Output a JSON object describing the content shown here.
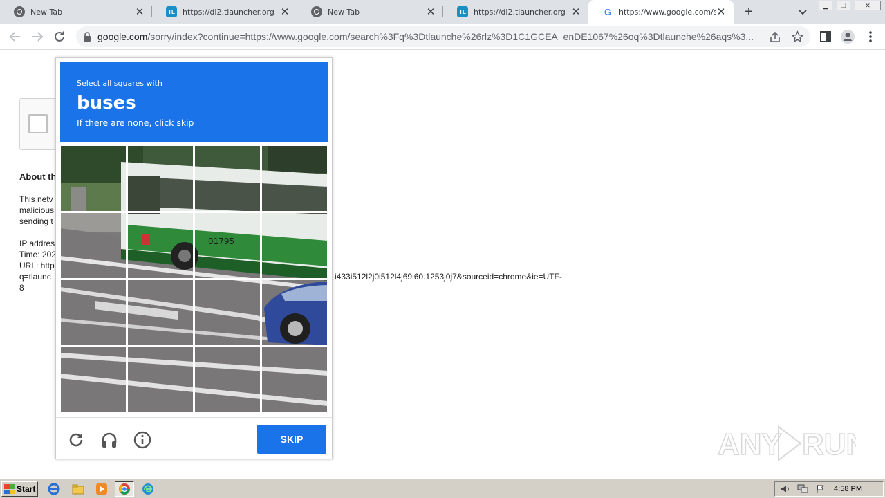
{
  "browser": {
    "tabs": [
      {
        "title": "New Tab",
        "favicon": "chrome-icon"
      },
      {
        "title": "https://dl2.tlauncher.org",
        "favicon": "tlauncher-icon"
      },
      {
        "title": "New Tab",
        "favicon": "chrome-icon"
      },
      {
        "title": "https://dl2.tlauncher.org",
        "favicon": "tlauncher-icon"
      },
      {
        "title": "https://www.google.com/search",
        "favicon": "google-icon",
        "active": true
      }
    ],
    "tab_close_glyph": "✕",
    "new_tab_glyph": "+",
    "url_host": "google.com",
    "url_path": "/sorry/index?continue=https://www.google.com/search%3Fq%3Dtlaunche%26rlz%3D1C1GCEA_enDE1067%26oq%3Dtlaunche%26aqs%3..."
  },
  "page": {
    "about_heading": "About th",
    "lines": [
      "This netv",
      "malicious",
      "sending t"
    ],
    "ip_label": "IP addres",
    "time_label": "Time: 202",
    "url_label": "URL: http",
    "url_line2_left": "q=tlaunc",
    "url_line2_right": "i433i512l2j0i512l4j69i60.1253j0j7&sourceid=chrome&ie=UTF-",
    "url_line3": "8"
  },
  "captcha": {
    "instruction": "Select all squares with",
    "target": "buses",
    "hint": "If there are none, click skip",
    "skip_label": "SKIP",
    "grid_size": 4,
    "bus_number": "01795",
    "accent": "#1a73e8"
  },
  "watermark": "ANY RUN",
  "taskbar": {
    "start_label": "Start",
    "clock": "4:58 PM"
  }
}
